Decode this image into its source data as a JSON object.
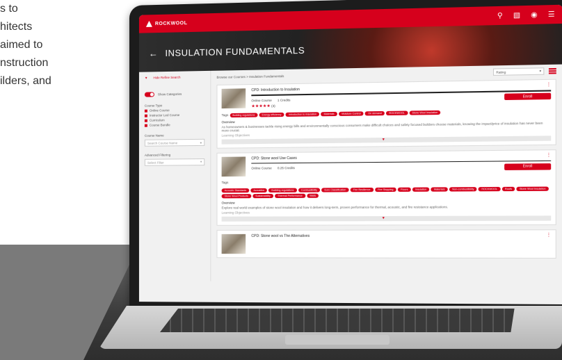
{
  "intro_lines": [
    "s to",
    "hitects",
    " aimed to",
    "nstruction",
    "ilders, and"
  ],
  "app": {
    "logo_text": "ROCKWOOL",
    "header_icons": [
      "search-icon",
      "cart-icon",
      "user-icon",
      "menu-icon"
    ],
    "back_glyph": "←",
    "page_title": "INSULATION FUNDAMENTALS"
  },
  "sidebar": {
    "hide_refine": "Hide Refine Search",
    "show_categories": "Show Categories",
    "course_type_label": "Course Type",
    "course_types": [
      "Online Course",
      "Instructor Led Course",
      "Curriculum",
      "Course Bundle"
    ],
    "course_name_label": "Course Name",
    "course_name_placeholder": "Search Course Name",
    "advanced_label": "Advanced Filtering",
    "advanced_value": "Select Filter"
  },
  "content": {
    "breadcrumb": "Browse our Courses  >  Insulation Fundamentals",
    "sort_value": "Rating",
    "enroll_label": "Enroll",
    "tags_label": "Tags",
    "overview_label": "Overview",
    "learning_label": "Learning Objectives",
    "cards": [
      {
        "title": "CPD: Introduction to Insulation",
        "type": "Online Course",
        "credits": "1 Credits",
        "stars": "★★★★★",
        "rating_count": "(3)",
        "tags": [
          "Building regulations",
          "Energy efficiency",
          "Introduction to Insulation",
          "Materials",
          "Moisture Control",
          "On demand",
          "ROCKWOOL",
          "Stone Wool Insulation"
        ],
        "overview": "As homeowners & businesses tackle rising energy bills and environmentally conscious consumers make difficult choices and safety focused builders choose materials, knowing the impact/price of insulation has never been more crucial."
      },
      {
        "title": "CPD: Stone wool Use Cases",
        "type": "Online Course",
        "credits": "0.25 Credits",
        "stars": "",
        "rating_count": "",
        "tags": [
          "Acoustic Standards",
          "Acoustics",
          "Building regulations",
          "Combustibility",
          "Euro Classification",
          "Fire Resilience",
          "Fire Stopping",
          "Floors",
          "Insulation",
          "Materials",
          "Non-combustibility",
          "ROCKWOOL",
          "Roofs",
          "Stone Wool Insulation",
          "Stone Wool Products",
          "Sustainability",
          "Thermal Performance",
          "Walls"
        ],
        "overview": "Explore real world examples of stone wool insulation and how it delivers long-term, proven performance for thermal, acoustic, and fire resistance applications."
      },
      {
        "title": "CPD: Stone wool vs The Alternatives",
        "type": "",
        "credits": "",
        "stars": "",
        "rating_count": "",
        "tags": [],
        "overview": ""
      }
    ]
  }
}
